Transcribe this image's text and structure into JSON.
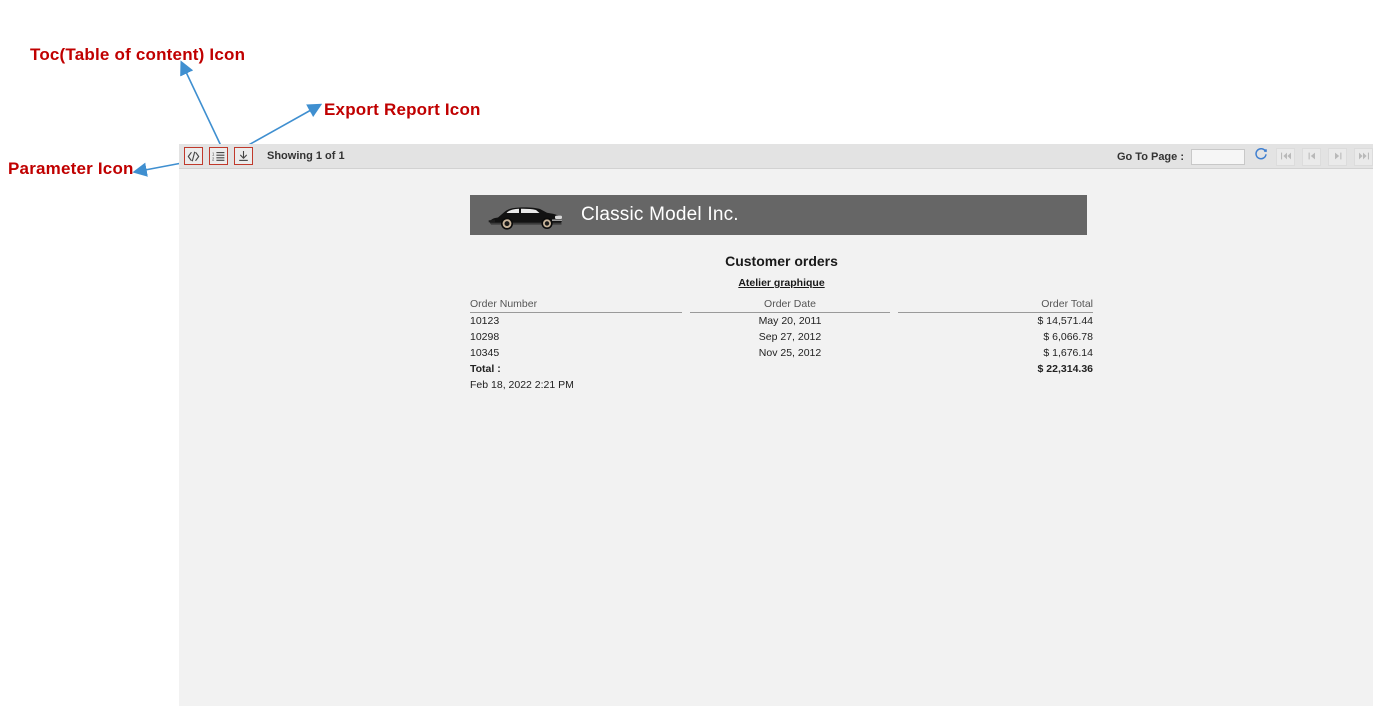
{
  "annotations": [
    {
      "name": "toc-annotation",
      "label": "Toc(Table of content) Icon"
    },
    {
      "name": "export-annotation",
      "label": "Export Report Icon"
    },
    {
      "name": "parameter-annotation",
      "label": "Parameter Icon"
    }
  ],
  "colors": {
    "annotation_text": "#c00000",
    "annotation_arrow": "#3f8fd0",
    "icon_border": "#c0392b",
    "banner_bg": "#666666",
    "viewer_bg": "#f2f2f2",
    "toolbar_bg": "#e3e3e3",
    "refresh_icon": "#3f7fd0"
  },
  "toolbar": {
    "buttons": [
      {
        "name": "parameter-button",
        "icon": "code-brackets-icon",
        "title": "Parameters"
      },
      {
        "name": "toc-button",
        "icon": "numbered-list-icon",
        "title": "Table of Contents"
      },
      {
        "name": "export-button",
        "icon": "download-arrow-icon",
        "title": "Export Report"
      }
    ],
    "showing_text": "Showing 1 of 1",
    "goto_page_label": "Go To Page :",
    "page_input_value": "",
    "page_input_placeholder": "",
    "refresh_icon": "refresh-icon",
    "pagination": [
      {
        "name": "first-page-button",
        "icon": "first-page-icon",
        "glyph": "⏮"
      },
      {
        "name": "previous-page-button",
        "icon": "previous-page-icon",
        "glyph": "◁"
      },
      {
        "name": "next-page-button",
        "icon": "next-page-icon",
        "glyph": "▷"
      },
      {
        "name": "last-page-button",
        "icon": "last-page-icon",
        "glyph": "⏭"
      }
    ]
  },
  "report": {
    "company_name": "Classic Model Inc.",
    "logo_icon": "classic-car-icon",
    "title": "Customer orders",
    "subtitle": "Atelier graphique",
    "columns": [
      "Order Number",
      "Order Date",
      "Order Total"
    ],
    "rows": [
      {
        "order_number": "10123",
        "order_date": "May 20, 2011",
        "order_total": "$ 14,571.44"
      },
      {
        "order_number": "10298",
        "order_date": "Sep 27, 2012",
        "order_total": "$ 6,066.78"
      },
      {
        "order_number": "10345",
        "order_date": "Nov 25, 2012",
        "order_total": "$ 1,676.14"
      }
    ],
    "total_label": "Total :",
    "total_value": "$ 22,314.36",
    "timestamp": "Feb 18, 2022 2:21 PM"
  }
}
